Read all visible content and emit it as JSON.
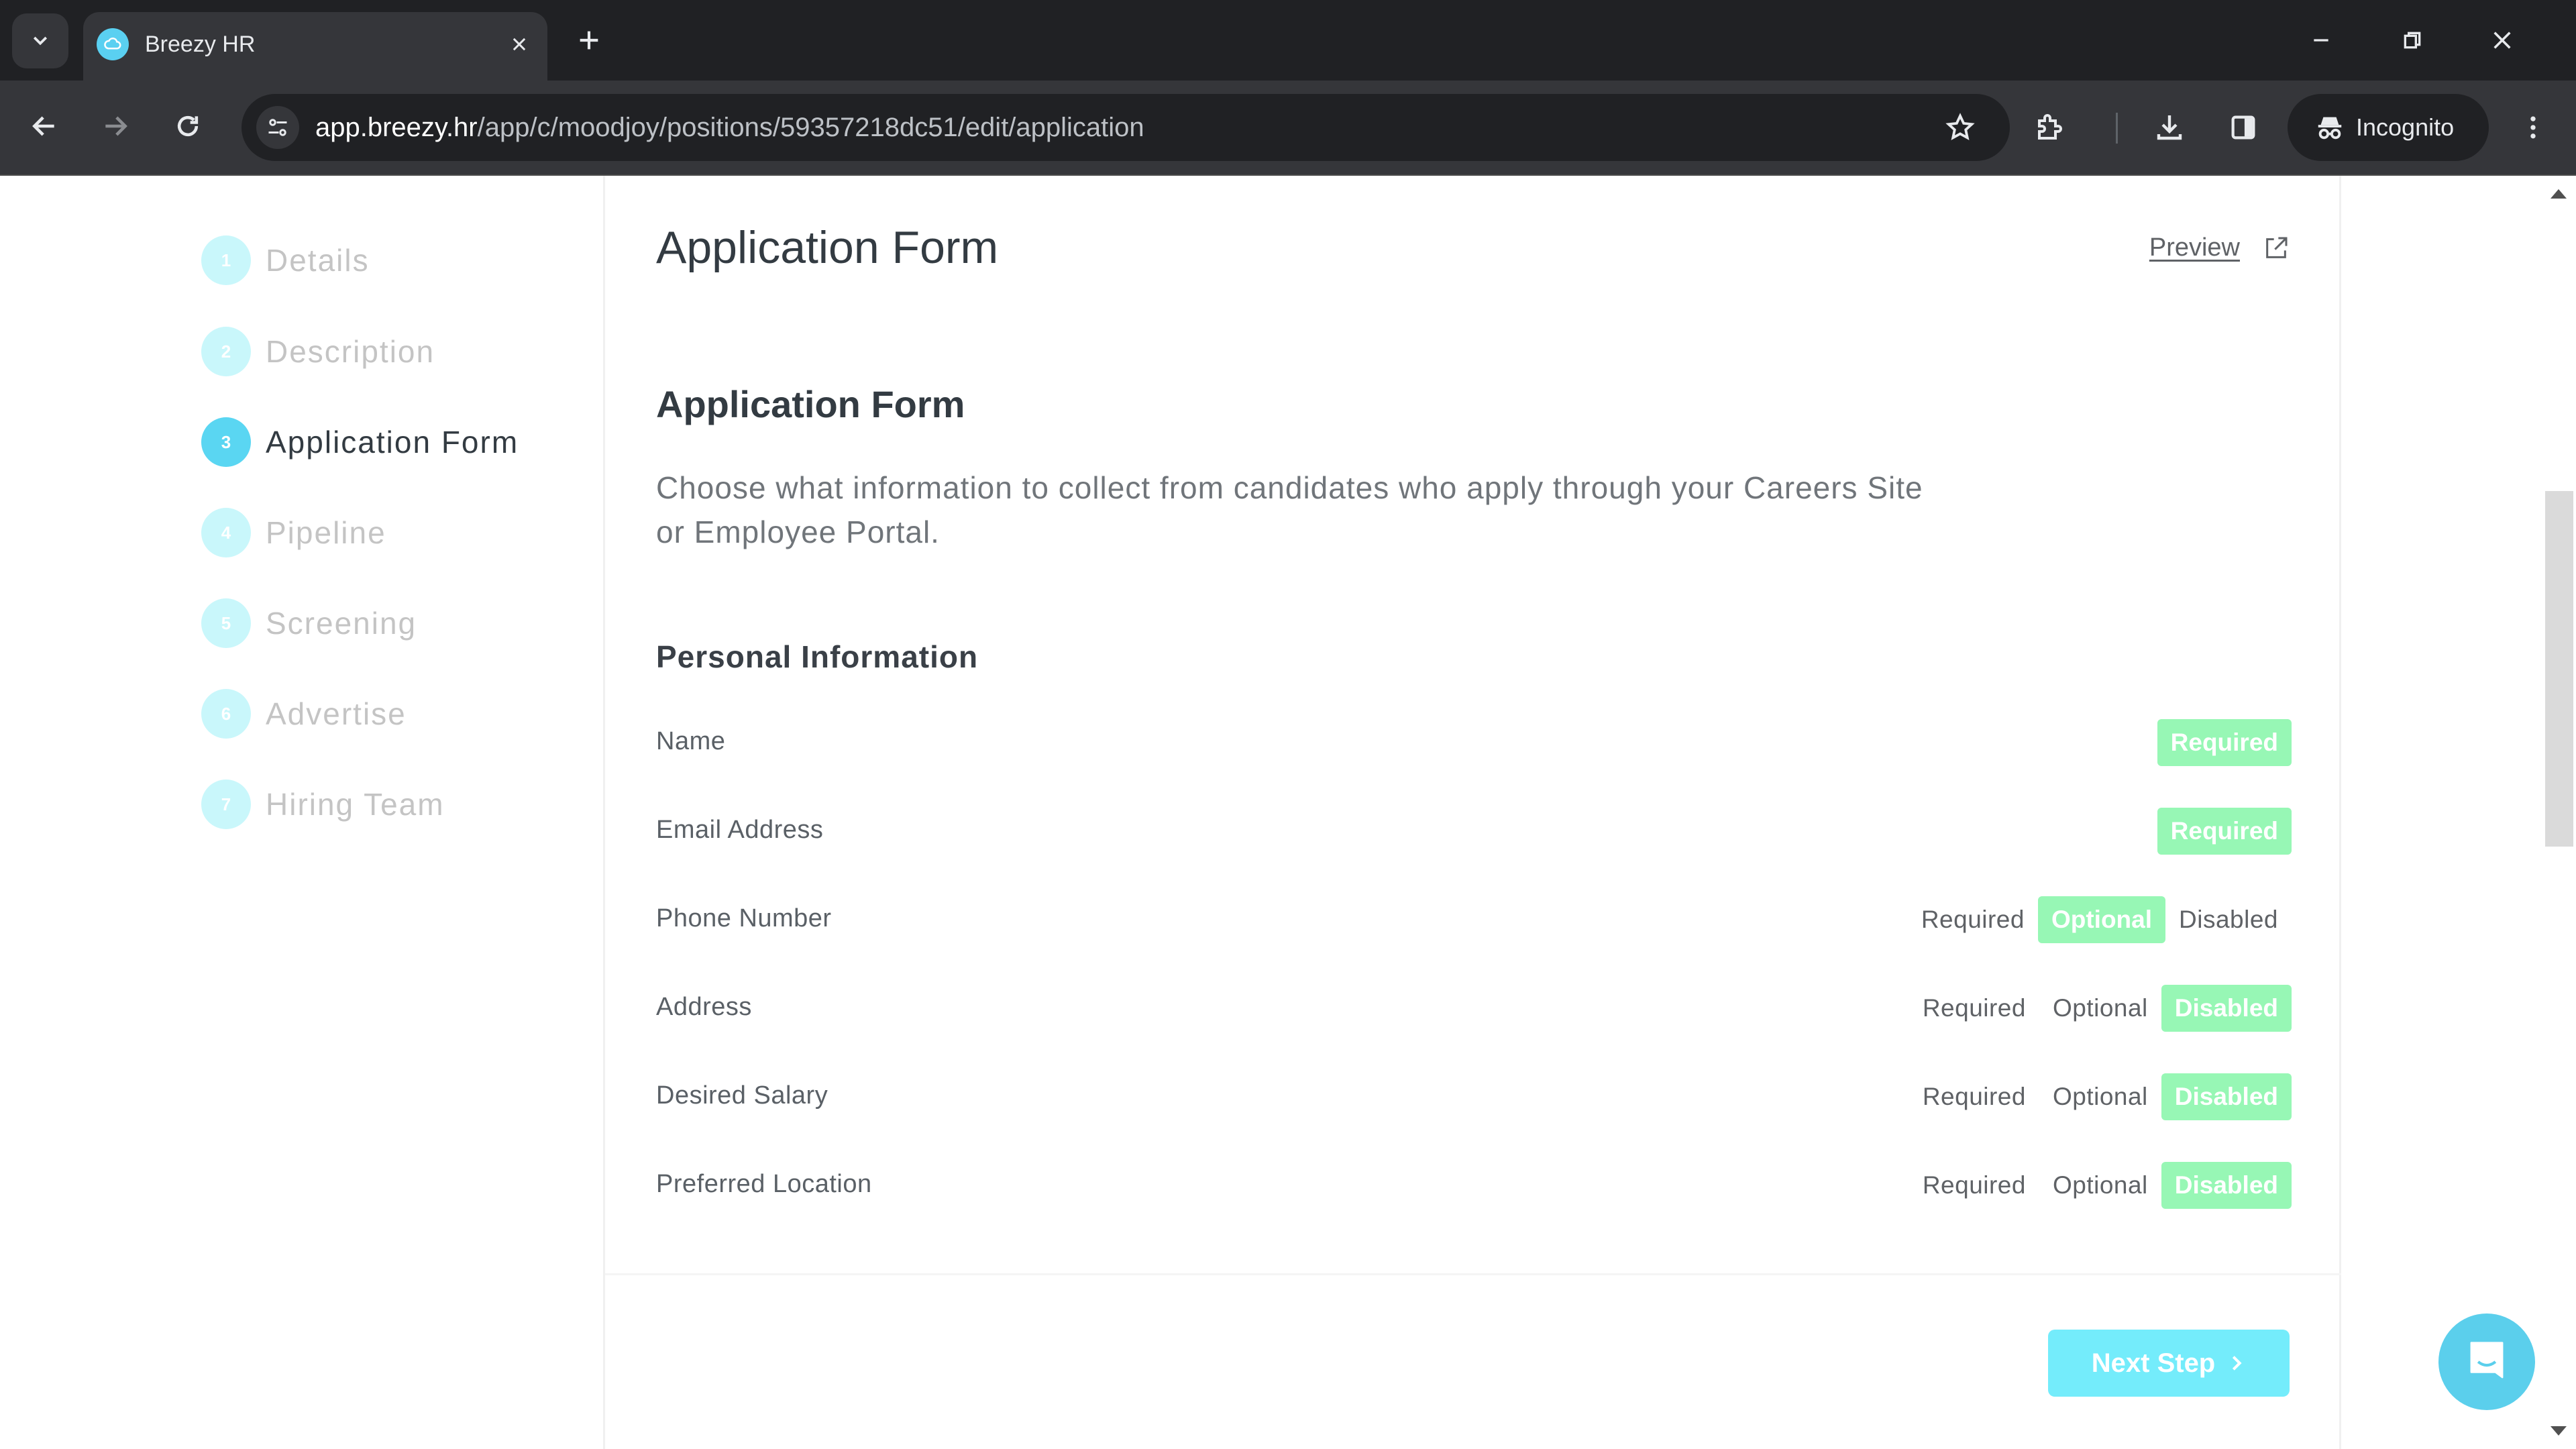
{
  "browser": {
    "tab": {
      "title": "Breezy HR",
      "favicon": "breezy-cloud-icon"
    },
    "url": {
      "host": "app.breezy.hr",
      "path": "/app/c/moodjoy/positions/59357218dc51/edit/application"
    },
    "profile_label": "Incognito",
    "icons": {
      "tab_search": "chevron-down-icon",
      "close_tab": "close-icon",
      "new_tab": "plus-icon",
      "minimize": "minimize-icon",
      "restore": "restore-icon",
      "close_window": "close-icon",
      "back": "arrow-left-icon",
      "forward": "arrow-right-icon",
      "reload": "reload-icon",
      "site_info": "tune-icon",
      "bookmark": "star-icon",
      "extensions": "puzzle-icon",
      "downloads": "download-icon",
      "side_panel": "side-panel-icon",
      "incognito": "incognito-icon",
      "menu": "kebab-menu-icon"
    }
  },
  "sidebar": {
    "steps": [
      {
        "number": "1",
        "label": "Details",
        "active": false
      },
      {
        "number": "2",
        "label": "Description",
        "active": false
      },
      {
        "number": "3",
        "label": "Application Form",
        "active": true
      },
      {
        "number": "4",
        "label": "Pipeline",
        "active": false
      },
      {
        "number": "5",
        "label": "Screening",
        "active": false
      },
      {
        "number": "6",
        "label": "Advertise",
        "active": false
      },
      {
        "number": "7",
        "label": "Hiring Team",
        "active": false
      }
    ]
  },
  "main": {
    "page_title": "Application Form",
    "preview_label": "Preview",
    "section_title": "Application Form",
    "section_description": "Choose what information to collect from candidates who apply through your Careers Site or Employee Portal.",
    "personal_info": {
      "title": "Personal Information",
      "fields": [
        {
          "label": "Name",
          "options": [
            "Required"
          ],
          "selected": "Required"
        },
        {
          "label": "Email Address",
          "options": [
            "Required"
          ],
          "selected": "Required"
        },
        {
          "label": "Phone Number",
          "options": [
            "Required",
            "Optional",
            "Disabled"
          ],
          "selected": "Optional"
        },
        {
          "label": "Address",
          "options": [
            "Required",
            "Optional",
            "Disabled"
          ],
          "selected": "Disabled"
        },
        {
          "label": "Desired Salary",
          "options": [
            "Required",
            "Optional",
            "Disabled"
          ],
          "selected": "Disabled"
        },
        {
          "label": "Preferred Location",
          "options": [
            "Required",
            "Optional",
            "Disabled"
          ],
          "selected": "Disabled"
        }
      ]
    },
    "next_step_label": "Next Step",
    "colors": {
      "accent_cyan": "#5ad6f2",
      "step_inactive": "#c9f7fb",
      "selected_green": "#97f7b5",
      "next_button": "#74ecfb"
    }
  },
  "chat_widget": {
    "icon": "chat-bubble-icon"
  }
}
